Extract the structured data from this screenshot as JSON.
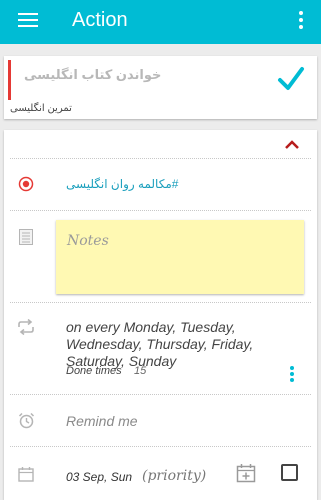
{
  "appbar": {
    "title": "Action",
    "menu_icon": "hamburger-menu-icon",
    "overflow_icon": "more-vertical-icon"
  },
  "task": {
    "name": "خواندن کتاب انگلیسی",
    "project": "تمرین انگلیسی",
    "priority_color": "#e53935",
    "complete_icon": "checkmark-icon"
  },
  "detail": {
    "collapse_icon": "chevron-up-icon",
    "context_tag": "#مکالمه روان انگلیسی",
    "notes_placeholder": "Notes",
    "repeat": {
      "text": "on every Monday, Tuesday, Wednesday, Thursday, Friday, Saturday, Sunday",
      "done_label": "Done times",
      "done_count": "15"
    },
    "reminder_placeholder": "Remind me",
    "due_date": "03 Sep, Sun",
    "priority_placeholder": "(priority)"
  },
  "colors": {
    "accent": "#00bcd4",
    "priority_red": "#e53935",
    "notes_bg": "#fff9b3",
    "tag_text": "#1a9fbd"
  }
}
